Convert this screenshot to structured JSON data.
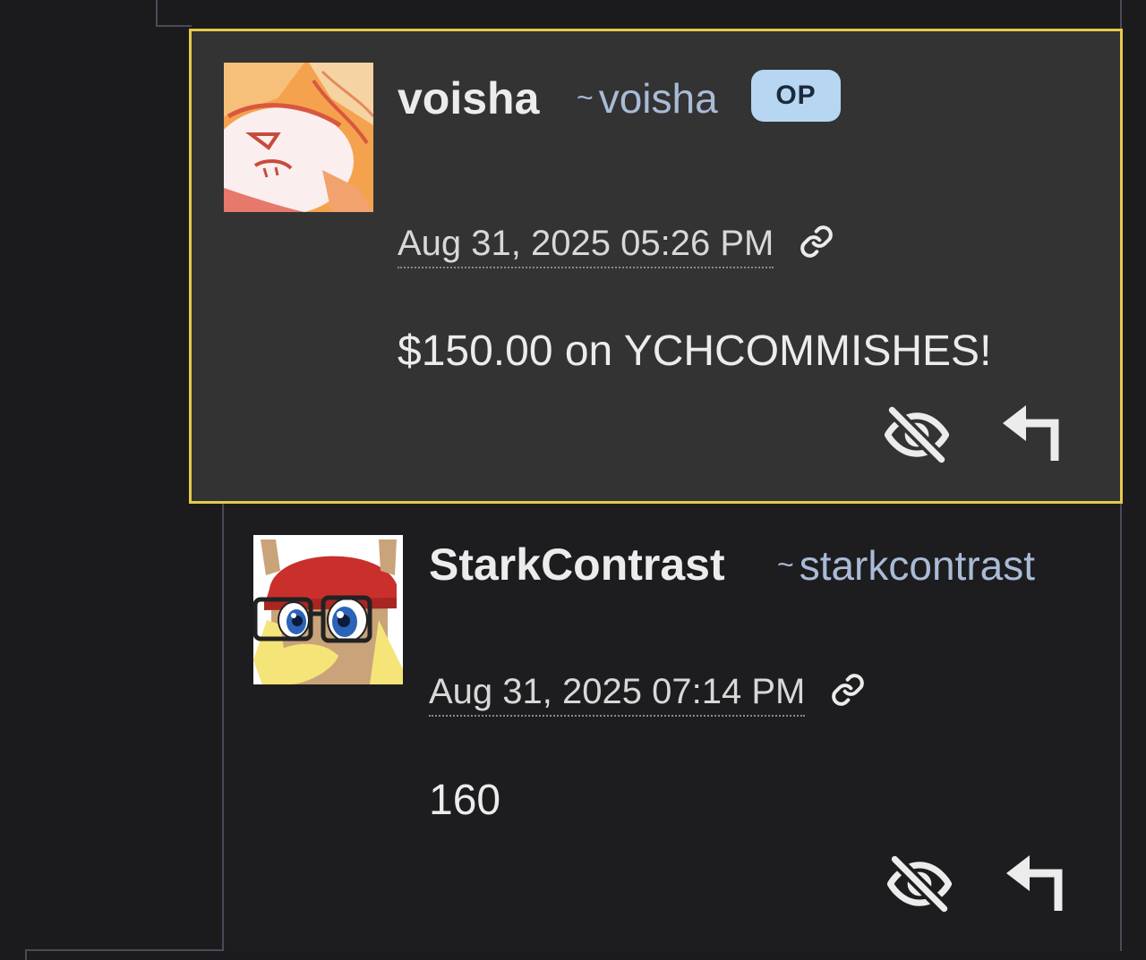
{
  "comments": [
    {
      "username": "voisha",
      "handle_prefix": "~",
      "handle": "voisha",
      "badge": "OP",
      "timestamp": "Aug 31, 2025 05:26 PM",
      "body": "$150.00 on YCHCOMMISHES!",
      "highlighted": true,
      "actions": [
        "hide-icon",
        "reply-icon"
      ]
    },
    {
      "username": "StarkContrast",
      "handle_prefix": "~",
      "handle": "starkcontrast",
      "timestamp": "Aug 31, 2025 07:14 PM",
      "body": "160",
      "highlighted": false,
      "actions": [
        "hide-icon",
        "reply-icon"
      ]
    }
  ],
  "colors": {
    "background": "#1b1b1d",
    "highlight_border": "#e7c94c",
    "highlighted_bg": "#333334",
    "handle": "#a9bbd6",
    "op_badge_bg": "#b7d6f1"
  }
}
